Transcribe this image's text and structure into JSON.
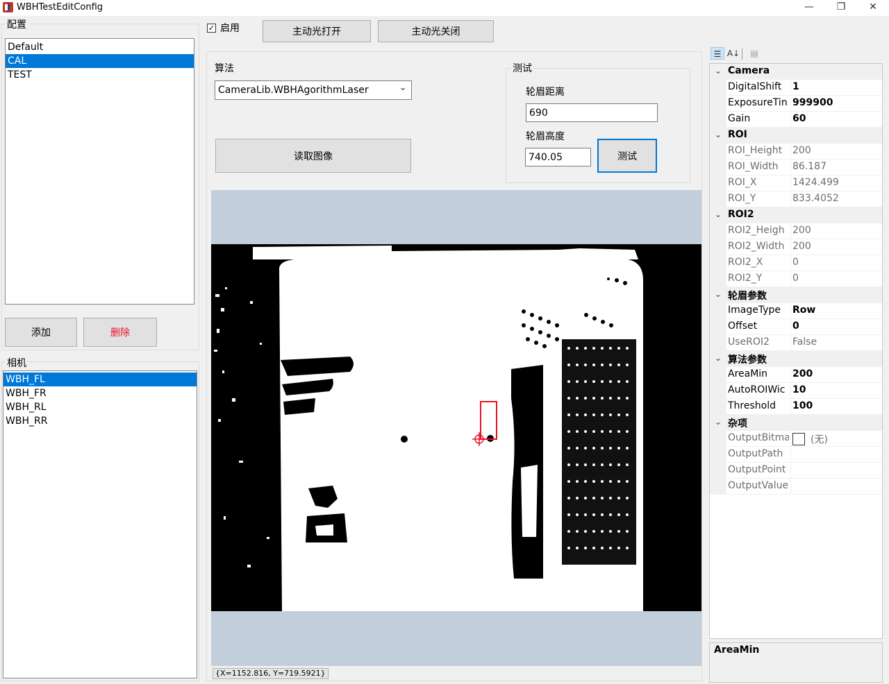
{
  "window": {
    "title": "WBHTestEditConfig",
    "controls": {
      "minimize": "—",
      "maximize": "❐",
      "close": "✕"
    }
  },
  "config_panel": {
    "label": "配置",
    "items": [
      "Default",
      "CAL",
      "TEST"
    ],
    "selected_index": 1,
    "add_label": "添加",
    "delete_label": "删除",
    "delete_color": "#e81123"
  },
  "camera_panel": {
    "label": "相机",
    "items": [
      "WBH_FL",
      "WBH_FR",
      "WBH_RL",
      "WBH_RR"
    ],
    "selected_index": 0
  },
  "enable": {
    "label": "启用",
    "checked": true,
    "check_mark": "✓"
  },
  "light": {
    "on_label": "主动光打开",
    "off_label": "主动光关闭"
  },
  "algorithm": {
    "label": "算法",
    "selected": "CameraLib.WBHAgorithmLaser",
    "arrow": "⌄",
    "read_image_label": "读取图像"
  },
  "test_group": {
    "label": "测试",
    "distance_label": "轮眉距离",
    "distance_value": "690",
    "height_label": "轮眉高度",
    "height_value": "740.05",
    "test_button_label": "测试"
  },
  "viewer": {
    "coordinate_readout": "{X=1152.816, Y=719.5921}",
    "background_color": "#c2ceda",
    "marker_color": "#e81123"
  },
  "property_grid": {
    "toolbar": {
      "categorized_icon": "categorized-icon",
      "alphabetical_icon": "alphabetical-icon",
      "pages_icon": "property-pages-icon",
      "categorized_glyph": "☰",
      "alphabetical_glyph": "A↓",
      "pages_glyph": "▤"
    },
    "categories": [
      {
        "name": "Camera",
        "props": [
          {
            "name": "DigitalShift",
            "value": "1",
            "bold": true
          },
          {
            "name": "ExposureTin",
            "value": "999900",
            "bold": true
          },
          {
            "name": "Gain",
            "value": "60",
            "bold": true
          }
        ]
      },
      {
        "name": "ROI",
        "props": [
          {
            "name": "ROI_Height",
            "value": "200",
            "readonly": true
          },
          {
            "name": "ROI_Width",
            "value": "86.187",
            "readonly": true
          },
          {
            "name": "ROI_X",
            "value": "1424.499",
            "readonly": true
          },
          {
            "name": "ROI_Y",
            "value": "833.4052",
            "readonly": true
          }
        ]
      },
      {
        "name": "ROI2",
        "props": [
          {
            "name": "ROI2_Heigh",
            "value": "200",
            "readonly": true
          },
          {
            "name": "ROI2_Width",
            "value": "200",
            "readonly": true
          },
          {
            "name": "ROI2_X",
            "value": "0",
            "readonly": true
          },
          {
            "name": "ROI2_Y",
            "value": "0",
            "readonly": true
          }
        ]
      },
      {
        "name": "轮眉参数",
        "props": [
          {
            "name": "ImageType",
            "value": "Row",
            "bold": true
          },
          {
            "name": "Offset",
            "value": "0",
            "bold": true
          },
          {
            "name": "UseROI2",
            "value": "False",
            "readonly": true
          }
        ]
      },
      {
        "name": "算法参数",
        "props": [
          {
            "name": "AreaMin",
            "value": "200",
            "bold": true
          },
          {
            "name": "AutoROIWic",
            "value": "10",
            "bold": true
          },
          {
            "name": "Threshold",
            "value": "100",
            "bold": true
          }
        ]
      },
      {
        "name": "杂项",
        "props": [
          {
            "name": "OutputBitma",
            "value": "(无)",
            "readonly": true,
            "swatch": true
          },
          {
            "name": "OutputPath",
            "value": "",
            "readonly": true
          },
          {
            "name": "OutputPoint",
            "value": "",
            "readonly": true
          },
          {
            "name": "OutputValue",
            "value": "",
            "readonly": true
          }
        ]
      }
    ],
    "chevron": "⌄",
    "help_title": "AreaMin"
  }
}
